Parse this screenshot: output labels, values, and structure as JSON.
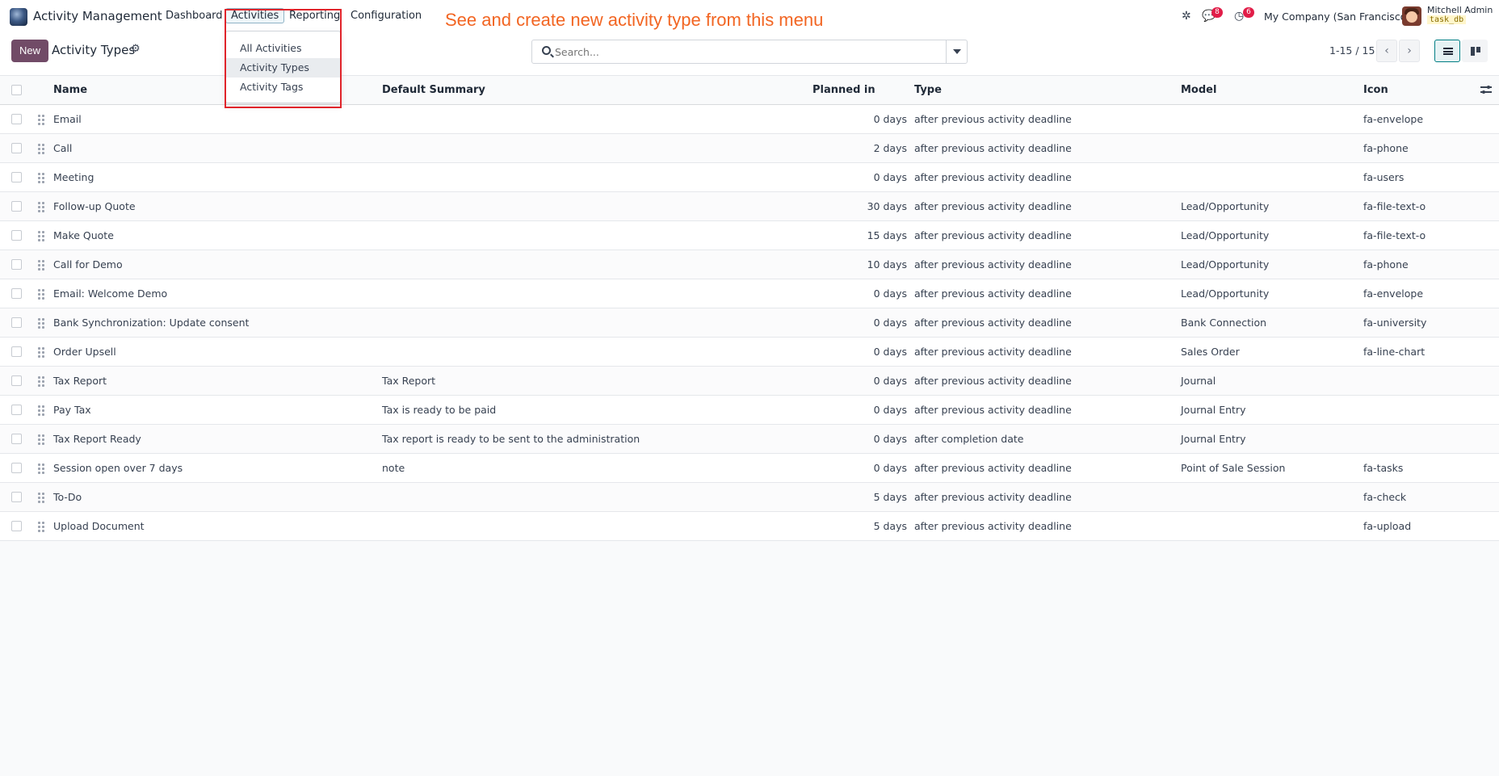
{
  "navbar": {
    "app_name": "Activity Management",
    "menu": [
      "Dashboard",
      "Activities",
      "Reporting",
      "Configuration"
    ],
    "messages_count": "8",
    "activities_count": "6",
    "company": "My Company (San Francisco)",
    "user_name": "Mitchell Admin",
    "db_name": "task_db"
  },
  "annotation": "See and create new activity type from this menu",
  "dropdown": {
    "items": [
      "All Activities",
      "Activity Types",
      "Activity Tags"
    ],
    "hover_index": 1
  },
  "control_panel": {
    "new_label": "New",
    "title": "Activity Types",
    "search_placeholder": "Search...",
    "pager": "1-15 / 15"
  },
  "table": {
    "columns": [
      "Name",
      "Default Summary",
      "Planned in",
      "Type",
      "Model",
      "Icon"
    ],
    "rows": [
      {
        "name": "Email",
        "summary": "",
        "planned": "0 days",
        "type": "after previous activity deadline",
        "model": "",
        "icon": "fa-envelope"
      },
      {
        "name": "Call",
        "summary": "",
        "planned": "2 days",
        "type": "after previous activity deadline",
        "model": "",
        "icon": "fa-phone"
      },
      {
        "name": "Meeting",
        "summary": "",
        "planned": "0 days",
        "type": "after previous activity deadline",
        "model": "",
        "icon": "fa-users"
      },
      {
        "name": "Follow-up Quote",
        "summary": "",
        "planned": "30 days",
        "type": "after previous activity deadline",
        "model": "Lead/Opportunity",
        "icon": "fa-file-text-o"
      },
      {
        "name": "Make Quote",
        "summary": "",
        "planned": "15 days",
        "type": "after previous activity deadline",
        "model": "Lead/Opportunity",
        "icon": "fa-file-text-o"
      },
      {
        "name": "Call for Demo",
        "summary": "",
        "planned": "10 days",
        "type": "after previous activity deadline",
        "model": "Lead/Opportunity",
        "icon": "fa-phone"
      },
      {
        "name": "Email: Welcome Demo",
        "summary": "",
        "planned": "0 days",
        "type": "after previous activity deadline",
        "model": "Lead/Opportunity",
        "icon": "fa-envelope"
      },
      {
        "name": "Bank Synchronization: Update consent",
        "summary": "",
        "planned": "0 days",
        "type": "after previous activity deadline",
        "model": "Bank Connection",
        "icon": "fa-university"
      },
      {
        "name": "Order Upsell",
        "summary": "",
        "planned": "0 days",
        "type": "after previous activity deadline",
        "model": "Sales Order",
        "icon": "fa-line-chart"
      },
      {
        "name": "Tax Report",
        "summary": "Tax Report",
        "planned": "0 days",
        "type": "after previous activity deadline",
        "model": "Journal",
        "icon": ""
      },
      {
        "name": "Pay Tax",
        "summary": "Tax is ready to be paid",
        "planned": "0 days",
        "type": "after previous activity deadline",
        "model": "Journal Entry",
        "icon": ""
      },
      {
        "name": "Tax Report Ready",
        "summary": "Tax report is ready to be sent to the administration",
        "planned": "0 days",
        "type": "after completion date",
        "model": "Journal Entry",
        "icon": ""
      },
      {
        "name": "Session open over 7 days",
        "summary": "note",
        "planned": "0 days",
        "type": "after previous activity deadline",
        "model": "Point of Sale Session",
        "icon": "fa-tasks"
      },
      {
        "name": "To-Do",
        "summary": "",
        "planned": "5 days",
        "type": "after previous activity deadline",
        "model": "",
        "icon": "fa-check"
      },
      {
        "name": "Upload Document",
        "summary": "",
        "planned": "5 days",
        "type": "after previous activity deadline",
        "model": "",
        "icon": "fa-upload"
      }
    ]
  }
}
